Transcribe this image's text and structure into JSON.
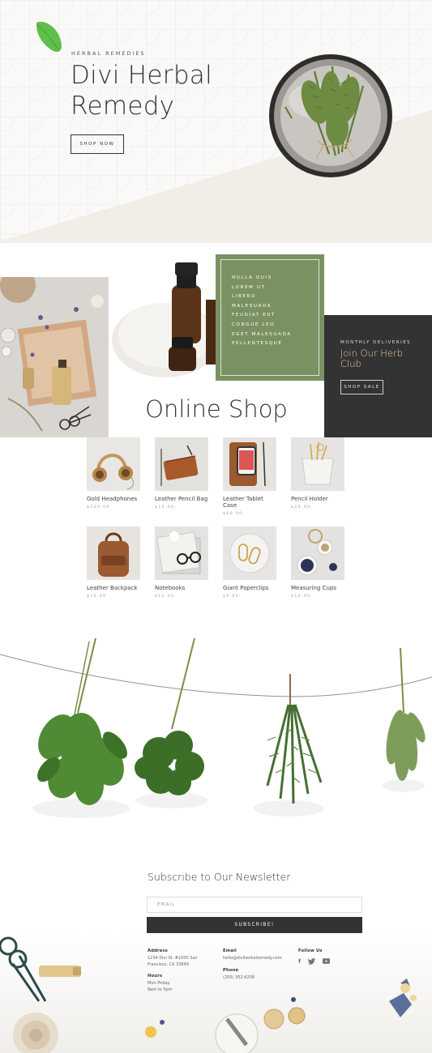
{
  "hero": {
    "eyebrow": "HERBAL REMEDIES",
    "title": "Divi Herbal Remedy",
    "button": "SHOP NOW"
  },
  "green_box": {
    "items": [
      "NULLA QUIS",
      "LOREM UT",
      "LIBERO",
      "MALESUADA",
      "FEUGIAT EUT",
      "CONGUE LEO",
      "EGET MALESUADA",
      "PELLENTESQUE"
    ]
  },
  "promo": {
    "eyebrow": "MONTHLY DELIVERIES",
    "title": "Join Our Herb Club",
    "button": "SHOP SALE"
  },
  "shop": {
    "title": "Online Shop",
    "products": [
      {
        "name": "Gold Headphones",
        "price": "$200.00"
      },
      {
        "name": "Leather Pencil Bag",
        "price": "$15.00"
      },
      {
        "name": "Leather Tablet Case",
        "price": "$60.00"
      },
      {
        "name": "Pencil Holder",
        "price": "$20.00"
      },
      {
        "name": "Leather Backpack",
        "price": "$75.00"
      },
      {
        "name": "Notebooks",
        "price": "$12.00"
      },
      {
        "name": "Giant Paperclips",
        "price": "$5.00"
      },
      {
        "name": "Measuring Cups",
        "price": "$10.00"
      }
    ]
  },
  "newsletter": {
    "title": "Subscribe to Our Newsletter",
    "email_placeholder": "EMAIL",
    "button": "SUBSCRIBE!"
  },
  "footer": {
    "address_label": "Address",
    "address_line1": "1234 Divi St. #1000 San",
    "address_line2": "Francisco, CA 33849",
    "hours_label": "Hours",
    "hours_line1": "Mon-Friday",
    "hours_line2": "8am to 5pm",
    "email_label": "Email",
    "email_value": "hello@diviherbalremedy.com",
    "phone_label": "Phone",
    "phone_value": "(255) 352-6258",
    "follow_label": "Follow Us",
    "social_icons": [
      "facebook-icon",
      "twitter-icon",
      "youtube-icon"
    ]
  }
}
